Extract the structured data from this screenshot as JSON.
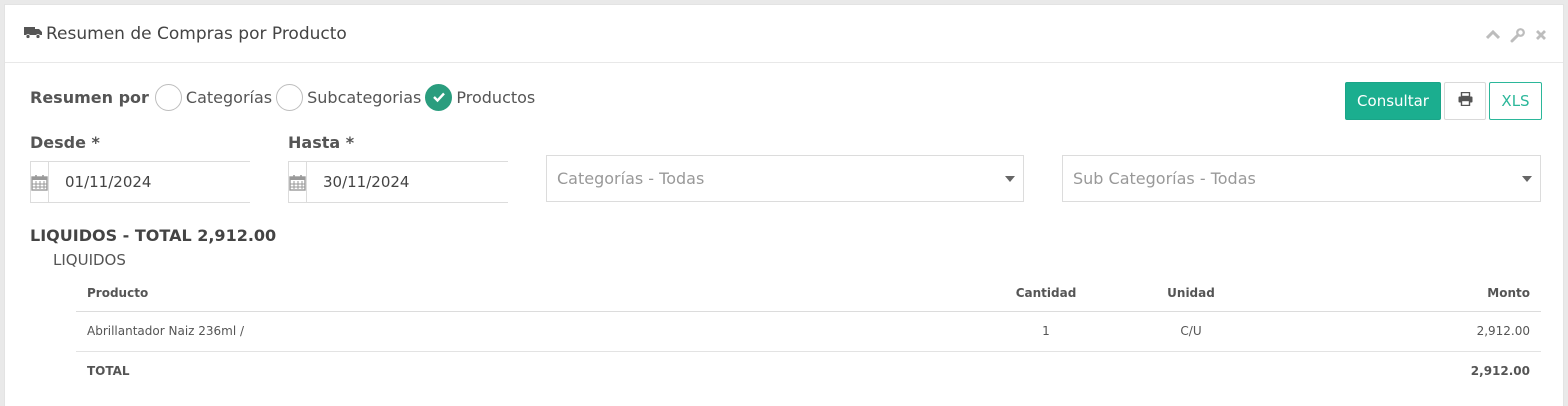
{
  "panel": {
    "title": "Resumen de Compras por Producto",
    "title_icon": "truck-icon",
    "tools": [
      "chevron-up-icon",
      "wrench-icon",
      "close-icon"
    ]
  },
  "filters": {
    "resumen_label": "Resumen por",
    "options": [
      {
        "label": "Categorías",
        "checked": false
      },
      {
        "label": "Subcategorias",
        "checked": false
      },
      {
        "label": "Productos",
        "checked": true
      }
    ],
    "desde_label": "Desde *",
    "desde_value": "01/11/2024",
    "hasta_label": "Hasta *",
    "hasta_value": "30/11/2024",
    "categoria_select": "Categorías - Todas",
    "subcategoria_select": "Sub Categorías - Todas"
  },
  "actions": {
    "consultar": "Consultar",
    "print_icon": "print-icon",
    "xls": "XLS"
  },
  "report": {
    "group_title": "LIQUIDOS - TOTAL 2,912.00",
    "subgroup": "LIQUIDOS",
    "columns": [
      "Producto",
      "Cantidad",
      "Unidad",
      "Monto"
    ],
    "rows": [
      {
        "producto": "Abrillantador Naiz 236ml /",
        "cantidad": "1",
        "unidad": "C/U",
        "monto": "2,912.00"
      }
    ],
    "total_label": "TOTAL",
    "total_value": "2,912.00"
  },
  "colors": {
    "accent": "#1bae8f",
    "check": "#2a9d7e"
  }
}
